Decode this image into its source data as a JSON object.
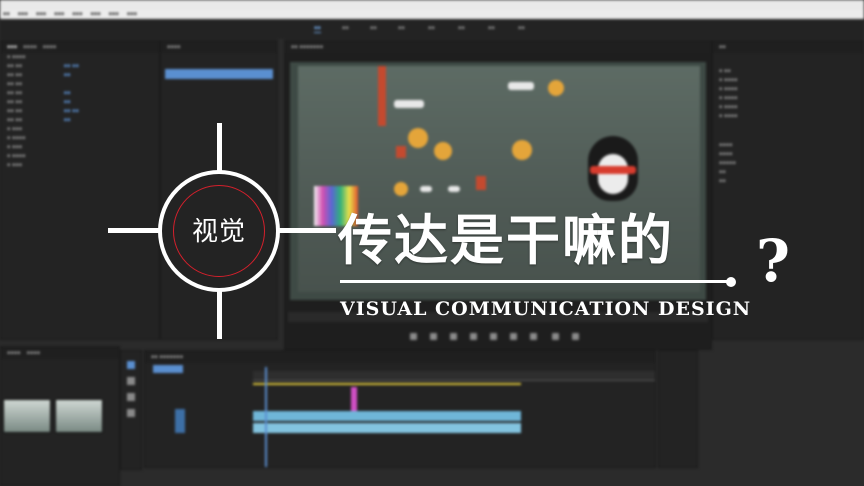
{
  "title_graphic": {
    "circle_label": "视觉",
    "main_title": "传达是干嘛的",
    "question_mark": "?",
    "subtitle": "VISUAL COMMUNICATION DESIGN"
  },
  "colors": {
    "accent_red": "#d4202c",
    "overlay_white": "#ffffff",
    "ui_bg": "#2b2b2b",
    "clip_blue": "#6fb6d8"
  },
  "icons": [
    "play-icon",
    "step-back-icon",
    "step-forward-icon",
    "selection-tool-icon",
    "razor-tool-icon",
    "pen-tool-icon",
    "hand-tool-icon"
  ]
}
